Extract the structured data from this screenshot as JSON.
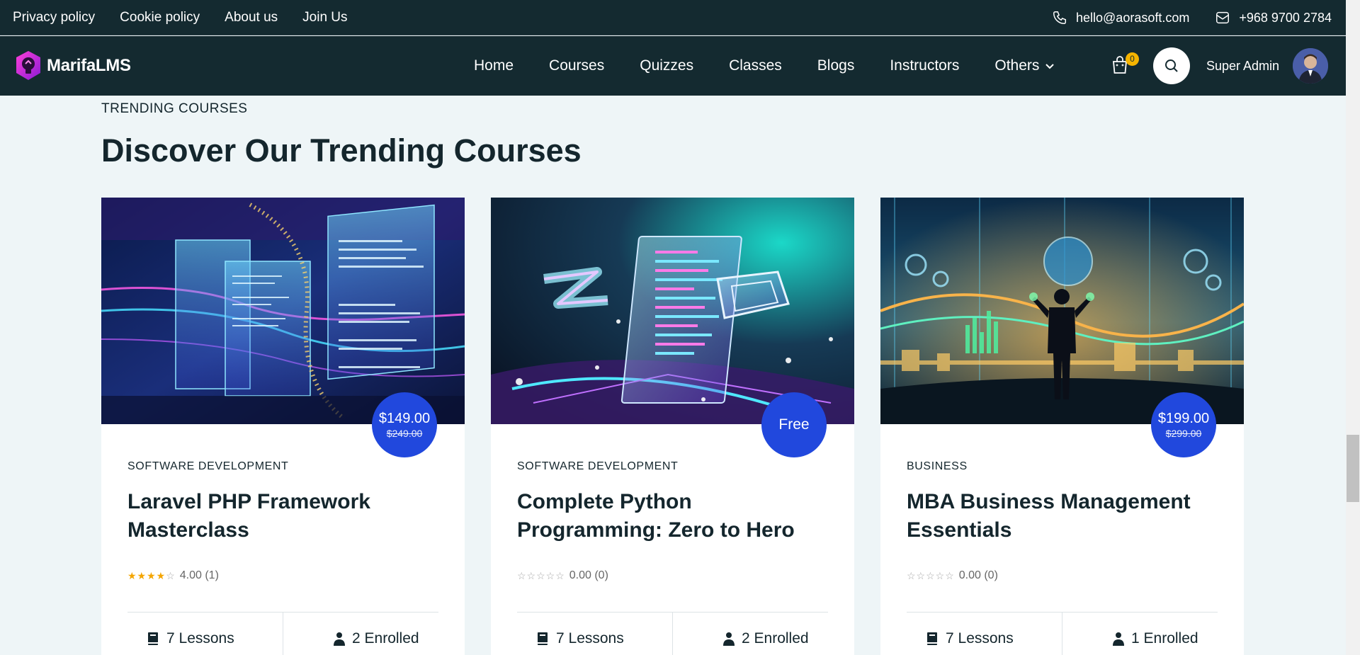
{
  "topbar": {
    "links": [
      "Privacy policy",
      "Cookie policy",
      "About us",
      "Join Us"
    ],
    "email": "hello@aorasoft.com",
    "phone": "+968 9700 2784"
  },
  "brand": {
    "name": "MarifaLMS",
    "accent": "#e020c8"
  },
  "nav": {
    "items": [
      "Home",
      "Courses",
      "Quizzes",
      "Classes",
      "Blogs",
      "Instructors",
      "Others"
    ],
    "cart_count": "0",
    "user_name": "Super Admin"
  },
  "section": {
    "eyebrow": "TRENDING COURSES",
    "heading": "Discover Our Trending Courses"
  },
  "courses": [
    {
      "category": "SOFTWARE DEVELOPMENT",
      "title": "Laravel PHP Framework Masterclass",
      "price": "$149.00",
      "old_price": "$249.00",
      "rating_value": 4,
      "rating_text": "4.00 (1)",
      "lessons": "7 Lessons",
      "enrolled": "2 Enrolled"
    },
    {
      "category": "SOFTWARE DEVELOPMENT",
      "title": "Complete Python Programming: Zero to Hero",
      "price": "Free",
      "old_price": "",
      "rating_value": 0,
      "rating_text": "0.00 (0)",
      "lessons": "7 Lessons",
      "enrolled": "2 Enrolled"
    },
    {
      "category": "BUSINESS",
      "title": "MBA Business Management Essentials",
      "price": "$199.00",
      "old_price": "$299.00",
      "rating_value": 0,
      "rating_text": "0.00 (0)",
      "lessons": "7 Lessons",
      "enrolled": "1 Enrolled"
    }
  ],
  "colors": {
    "header_bg": "#142a30",
    "price_badge": "#2148dd",
    "star": "#f4a500",
    "page_bg": "#eef5f7"
  }
}
